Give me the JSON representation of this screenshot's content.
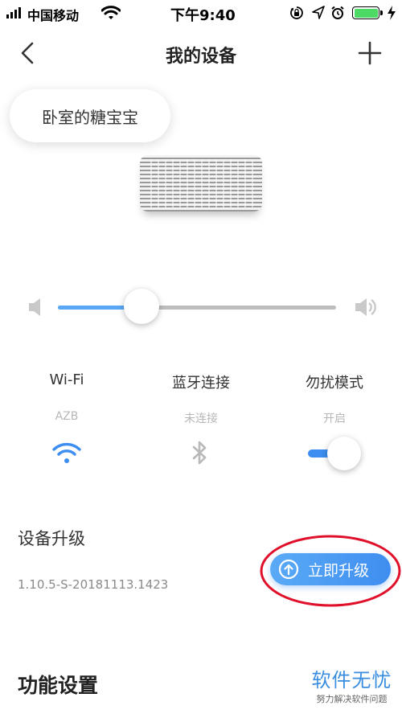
{
  "status_bar": {
    "carrier": "中国移动",
    "time": "下午9:40"
  },
  "nav": {
    "title": "我的设备",
    "back_icon": "chevron-left-icon",
    "add_icon": "plus-icon"
  },
  "device": {
    "name": "卧室的糖宝宝"
  },
  "volume": {
    "level": 0.3
  },
  "status": {
    "wifi": {
      "label": "Wi-Fi",
      "value": "AZB"
    },
    "bluetooth": {
      "label": "蓝牙连接",
      "value": "未连接"
    },
    "dnd": {
      "label": "勿扰模式",
      "value": "开启",
      "on": true
    }
  },
  "upgrade": {
    "title": "设备升级",
    "version": "1.10.5-S-20181113.1423",
    "button_label": "立即升级"
  },
  "features": {
    "title": "功能设置"
  },
  "watermark": {
    "main": "软件无忧",
    "sub": "努力解决软件问题"
  },
  "colors": {
    "accent": "#3f8ef0",
    "annotation": "#e0102a"
  }
}
